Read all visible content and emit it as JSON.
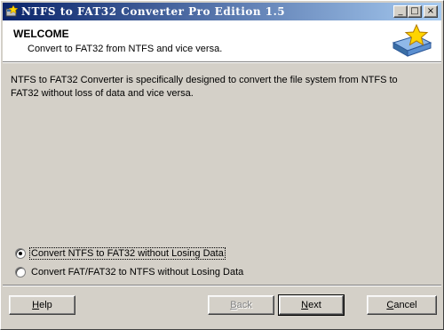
{
  "window": {
    "title": "NTFS to FAT32 Converter Pro Edition 1.5",
    "minimize_glyph": "_",
    "maximize_glyph": "□",
    "close_glyph": "×"
  },
  "header": {
    "title": "WELCOME",
    "subtitle": "Convert to FAT32 from NTFS and vice versa.",
    "graphic_icon": "drive-star-icon"
  },
  "description": "NTFS to FAT32 Converter is specifically designed to convert the file system from NTFS to FAT32 without loss of data and vice versa.",
  "options": [
    {
      "label": "Convert NTFS to FAT32 without Losing Data",
      "selected": true
    },
    {
      "label": "Convert FAT/FAT32 to NTFS without Losing Data",
      "selected": false
    }
  ],
  "buttons": {
    "help": {
      "first": "H",
      "rest": "elp"
    },
    "back": {
      "first": "B",
      "rest": "ack",
      "enabled": false
    },
    "next": {
      "first": "N",
      "rest": "ext"
    },
    "cancel": {
      "first": "C",
      "rest": "ancel"
    }
  },
  "colors": {
    "title_gradient_start": "#0a246a",
    "title_gradient_end": "#a6caf0",
    "face": "#d4d0c8"
  }
}
